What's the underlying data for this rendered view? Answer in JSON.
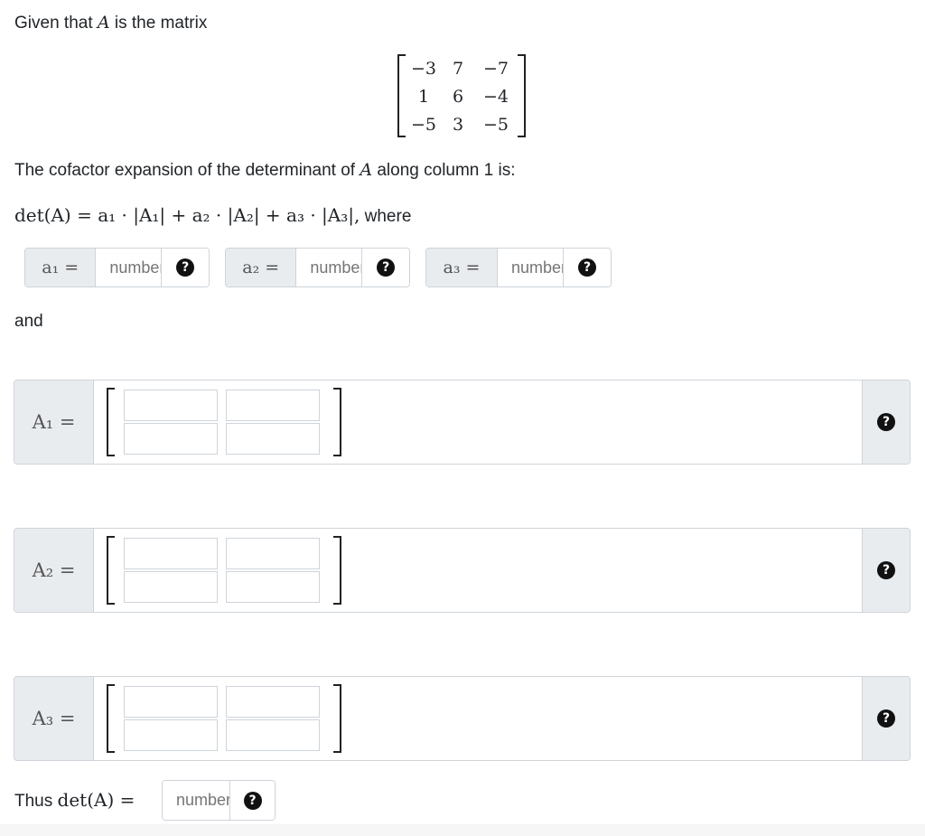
{
  "intro": {
    "prefix": "Given that",
    "var": "A",
    "suffix": "is the matrix"
  },
  "matrix": [
    [
      "−3",
      "7",
      "−7"
    ],
    [
      "1",
      "6",
      "−4"
    ],
    [
      "−5",
      "3",
      "−5"
    ]
  ],
  "cofactor_text": {
    "prefix": "The cofactor expansion of the determinant of",
    "var": "A",
    "suffix": "along column 1 is:"
  },
  "formula": {
    "math": "det(A) = a₁ · |A₁| + a₂ · |A₂| + a₃ · |A₃|,",
    "suffix": "where"
  },
  "coeff_inputs": [
    {
      "label": "a₁ =",
      "placeholder": "number"
    },
    {
      "label": "a₂ =",
      "placeholder": "number"
    },
    {
      "label": "a₃ =",
      "placeholder": "number"
    }
  ],
  "and_text": "and",
  "minor_rows": [
    {
      "label": "A₁ ="
    },
    {
      "label": "A₂ ="
    },
    {
      "label": "A₃ ="
    }
  ],
  "thus": {
    "prefix": "Thus",
    "math": "det(A) =",
    "placeholder": "number"
  },
  "icons": {
    "help": "question-circle-icon"
  },
  "help_glyph": "?",
  "colors": {
    "addon_bg": "#e9ecef",
    "border": "#ced4da",
    "text": "#212529",
    "placeholder": "#6c757d"
  }
}
